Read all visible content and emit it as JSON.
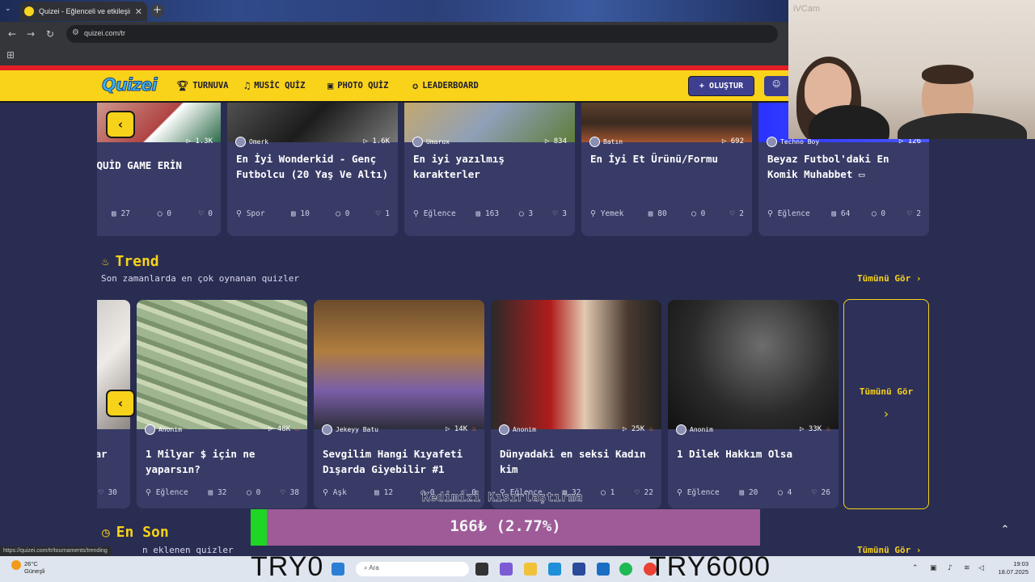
{
  "browser": {
    "tab_title": "Quizei - Eğlenceli ve etkileşimli",
    "url": "quizei.com/tr",
    "status_url": "https://quizei.com/tr/tournaments/trending"
  },
  "nav": {
    "logo": "Quizei",
    "items": [
      "TURNUVA",
      "MUSİC QUİZ",
      "PHOTO QUİZ",
      "LEADERBOARD"
    ],
    "create": "+ OLUŞTUR"
  },
  "top_row": [
    {
      "author": "",
      "plays": "1.3K",
      "title": "SQUİD GAME ERİN",
      "category": "",
      "count": "27",
      "comments": "0",
      "likes": "0"
    },
    {
      "author": "Omerk",
      "plays": "1.6K",
      "title": "En İyi Wonderkid - Genç Futbolcu (20 Yaş Ve Altı)",
      "category": "Spor",
      "count": "10",
      "comments": "0",
      "likes": "1"
    },
    {
      "author": "Umarux",
      "plays": "834",
      "title": "En iyi yazılmış karakterler",
      "category": "Eğlence",
      "count": "163",
      "comments": "3",
      "likes": "3"
    },
    {
      "author": "Batın",
      "plays": "692",
      "title": "En İyi Et Ürünü/Formu",
      "category": "Yemek",
      "count": "80",
      "comments": "0",
      "likes": "2"
    },
    {
      "author": "Techno Boy",
      "plays": "126",
      "title": "Beyaz Futbol'daki En Komik Muhabbet ▭",
      "category": "Eğlence",
      "count": "64",
      "comments": "0",
      "likes": "2"
    }
  ],
  "trend": {
    "title": "Trend",
    "subtitle": "Son zamanlarda en çok oynanan quizler",
    "see_all": "Tümünü Gör ›",
    "partial": {
      "title": "lar",
      "likes": "30"
    },
    "cards": [
      {
        "author": "Anonim",
        "plays": "48K",
        "title": "1 Milyar $ için ne yaparsın?",
        "category": "Eğlence",
        "count": "32",
        "comments": "0",
        "likes": "38"
      },
      {
        "author": "Jekeyy Batu",
        "plays": "14K",
        "title": "Sevgilim Hangi Kıyafeti Dışarda Giyebilir #1",
        "category": "Aşk",
        "count": "12",
        "comments": "0",
        "likes": "0"
      },
      {
        "author": "Anonim",
        "plays": "25K",
        "title": "Dünyadaki en seksi Kadın kim",
        "category": "Eğlence",
        "count": "32",
        "comments": "1",
        "likes": "22"
      },
      {
        "author": "Anonim",
        "plays": "33K",
        "title": "1 Dilek Hakkım Olsa",
        "category": "Eğlence",
        "count": "20",
        "comments": "4",
        "likes": "26"
      }
    ],
    "see_all_card": "Tümünü Gör"
  },
  "latest": {
    "title": "En Son",
    "subtitle": "n eklenen quizler",
    "see_all": "Tümünü Gör ›"
  },
  "overlay": {
    "caption": "Kedimizi Kısırlaştırma",
    "amount": "166₺ (2.77%)",
    "progress": 0.0277,
    "min": "TRY0",
    "max": "TRY6000"
  },
  "webcam": {
    "label": "iVCam"
  },
  "taskbar": {
    "temp": "26°C",
    "weather": "Güneşli",
    "search": "Ara",
    "time": "19:03",
    "date": "18.07.2025"
  }
}
